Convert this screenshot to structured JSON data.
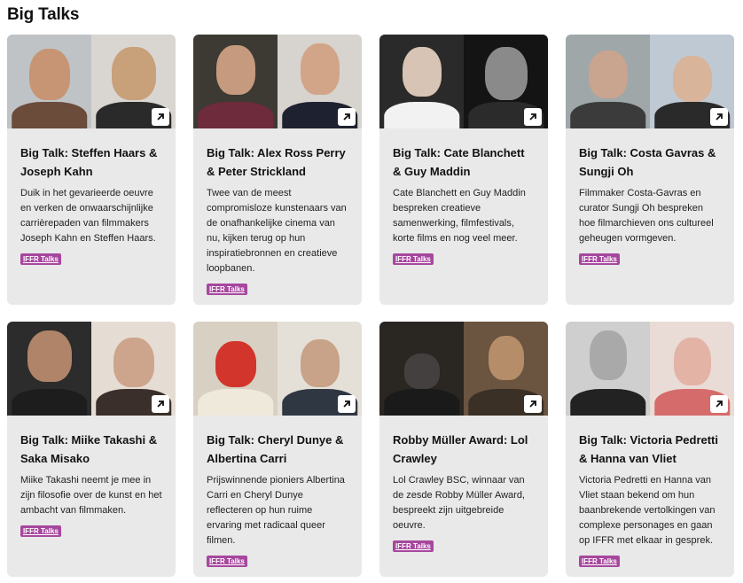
{
  "section": {
    "title": "Big Talks"
  },
  "cards": [
    {
      "title": "Big Talk: Steffen Haars & Joseph Kahn",
      "description": "Duik in het gevarieerde oeuvre en verken de onwaarschijnlijke carrièrepaden van filmmakers Joseph Kahn en Steffen Haars.",
      "tag": "IFFR Talks",
      "colors": {
        "left_bg": "#bfc3c6",
        "left_head": "#c79574",
        "left_body": "#6b4b3a",
        "right_bg": "#d9d6d2",
        "right_head": "#c8a07a",
        "right_body": "#2a2a2a"
      }
    },
    {
      "title": "Big Talk: Alex Ross Perry & Peter Strickland",
      "description": "Twee van de meest compromisloze kunstenaars van de onafhankelijke cinema van nu, kijken terug op hun inspiratiebronnen en creatieve loopbanen.",
      "tag": "IFFR Talks",
      "colors": {
        "left_bg": "#3d3a33",
        "left_head": "#c59a7e",
        "left_body": "#6e2b3b",
        "right_bg": "#d7d3ce",
        "right_head": "#d2a589",
        "right_body": "#1e2230"
      }
    },
    {
      "title": "Big Talk: Cate Blanchett & Guy Maddin",
      "description": "Cate Blanchett en Guy Maddin bespreken creatieve samenwerking, filmfestivals, korte films en nog veel meer.",
      "tag": "IFFR Talks",
      "colors": {
        "left_bg": "#2a2a2a",
        "left_head": "#d8c4b4",
        "left_body": "#f2f2f2",
        "right_bg": "#141414",
        "right_head": "#8a8a8a",
        "right_body": "#2b2b2b"
      }
    },
    {
      "title": "Big Talk: Costa Gavras & Sungji Oh",
      "description": "Filmmaker Costa-Gavras en curator Sungji Oh bespreken hoe filmarchieven ons cultureel geheugen vormgeven.",
      "tag": "IFFR Talks",
      "colors": {
        "left_bg": "#9fa7a9",
        "left_head": "#c9a48f",
        "left_body": "#3b3b3b",
        "right_bg": "#bfc9d4",
        "right_head": "#d8b49a",
        "right_body": "#2a2a2a"
      }
    },
    {
      "title": "Big Talk: Miike Takashi & Saka Misako",
      "description": "Miike Takashi neemt je mee in zijn filosofie over de kunst en het ambacht van filmmaken.",
      "tag": "IFFR Talks",
      "colors": {
        "left_bg": "#2c2c2c",
        "left_head": "#b08468",
        "left_body": "#1d1d1d",
        "right_bg": "#e5ddd4",
        "right_head": "#cda58c",
        "right_body": "#3a2f2a"
      }
    },
    {
      "title": "Big Talk: Cheryl Dunye & Albertina Carri",
      "description": "Prijswinnende pioniers Albertina Carri en Cheryl Dunye reflecteren op hun ruime ervaring met radicaal queer filmen.",
      "tag": "IFFR Talks",
      "colors": {
        "left_bg": "#d8d0c2",
        "left_head": "#d2352c",
        "left_body": "#efe9dc",
        "right_bg": "#e4e0d8",
        "right_head": "#c8a389",
        "right_body": "#2f3742"
      }
    },
    {
      "title": "Robby Müller Award: Lol Crawley",
      "description": "Lol Crawley BSC, winnaar van de zesde Robby Müller Award, bespreekt zijn uitgebreide oeuvre.",
      "tag": "IFFR Talks",
      "colors": {
        "left_bg": "#2a2622",
        "left_head": "#444040",
        "left_body": "#1a1a1a",
        "right_bg": "#6b5440",
        "right_head": "#b58d68",
        "right_body": "#3a3026"
      }
    },
    {
      "title": "Big Talk: Victoria Pedretti & Hanna van Vliet",
      "description": "Victoria Pedretti en Hanna van Vliet staan bekend om hun baanbrekende vertolkingen van complexe personages en gaan op IFFR met elkaar in gesprek.",
      "tag": "IFFR Talks",
      "colors": {
        "left_bg": "#cfcfcf",
        "left_head": "#a9a9a9",
        "left_body": "#222222",
        "right_bg": "#e9dcd6",
        "right_head": "#e3b3a6",
        "right_body": "#d56b6b"
      }
    }
  ]
}
